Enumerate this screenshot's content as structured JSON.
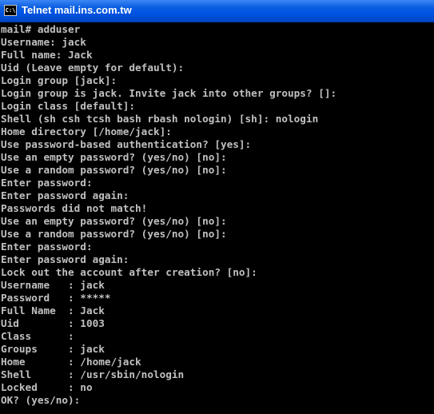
{
  "window": {
    "title": "Telnet mail.ins.com.tw",
    "icon_text": "C:\\",
    "icon_name": "console-icon"
  },
  "colors": {
    "titlebar": "#0054e3",
    "background": "#000000",
    "text": "#c0c0c0"
  },
  "terminal": {
    "lines": [
      "mail# adduser",
      "Username: jack",
      "Full name: Jack",
      "Uid (Leave empty for default):",
      "Login group [jack]:",
      "Login group is jack. Invite jack into other groups? []:",
      "Login class [default]:",
      "Shell (sh csh tcsh bash rbash nologin) [sh]: nologin",
      "Home directory [/home/jack]:",
      "Use password-based authentication? [yes]:",
      "Use an empty password? (yes/no) [no]:",
      "Use a random password? (yes/no) [no]:",
      "Enter password:",
      "Enter password again:",
      "Passwords did not match!",
      "Use an empty password? (yes/no) [no]:",
      "Use a random password? (yes/no) [no]:",
      "Enter password:",
      "Enter password again:",
      "Lock out the account after creation? [no]:",
      "Username   : jack",
      "Password   : *****",
      "Full Name  : Jack",
      "Uid        : 1003",
      "Class      :",
      "Groups     : jack",
      "Home       : /home/jack",
      "Shell      : /usr/sbin/nologin",
      "Locked     : no",
      "OK? (yes/no):"
    ]
  }
}
